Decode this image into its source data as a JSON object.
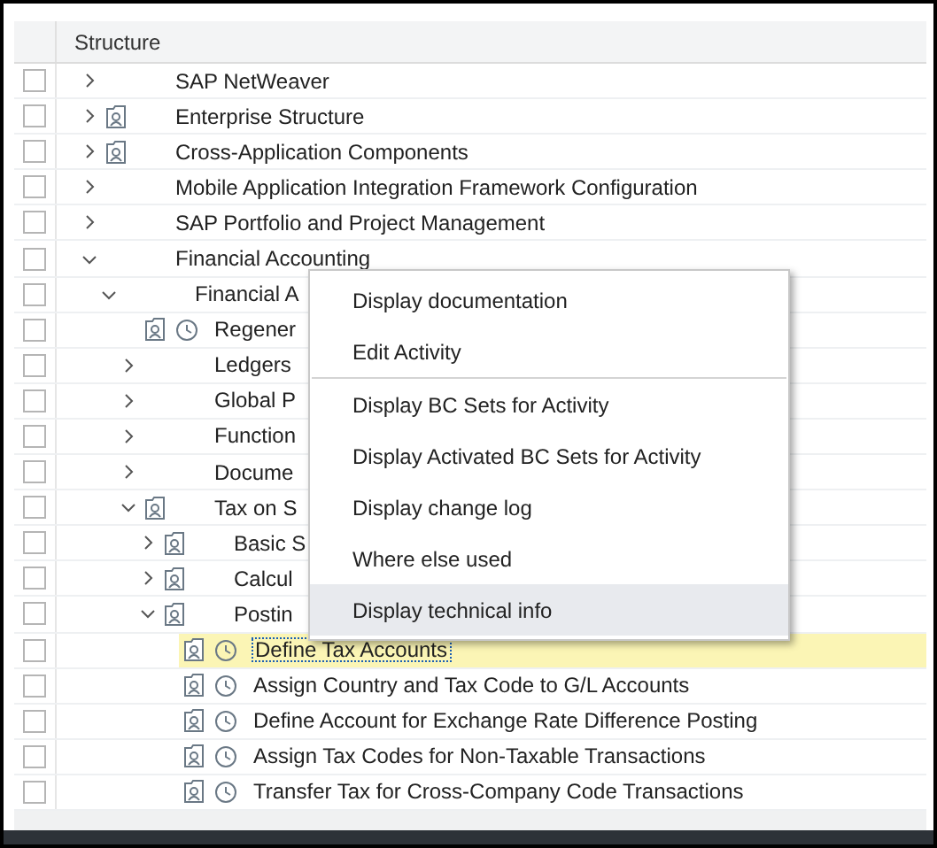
{
  "table": {
    "columns": [
      "Structure"
    ],
    "tree": [
      {
        "label": "SAP NetWeaver",
        "expanded": false,
        "doc_icon": false,
        "clock_icon": false,
        "checked": false,
        "selected": false
      },
      {
        "label": "Enterprise Structure",
        "expanded": false,
        "doc_icon": true,
        "clock_icon": false,
        "checked": false,
        "selected": false
      },
      {
        "label": "Cross-Application Components",
        "expanded": false,
        "doc_icon": true,
        "clock_icon": false,
        "checked": false,
        "selected": false
      },
      {
        "label": "Mobile Application Integration Framework Configuration",
        "expanded": false,
        "doc_icon": false,
        "clock_icon": false,
        "checked": false,
        "selected": false
      },
      {
        "label": "SAP Portfolio and Project Management",
        "expanded": false,
        "doc_icon": false,
        "clock_icon": false,
        "checked": false,
        "selected": false
      },
      {
        "label": "Financial Accounting",
        "expanded": true,
        "doc_icon": false,
        "clock_icon": false,
        "checked": false,
        "selected": false,
        "children": [
          {
            "label": "Financial A",
            "expanded": true,
            "doc_icon": false,
            "clock_icon": false,
            "checked": false,
            "selected": false,
            "children": [
              {
                "label": "Regener",
                "doc_icon": true,
                "clock_icon": true,
                "checked": false,
                "selected": false
              },
              {
                "label": "Ledgers",
                "expanded": false,
                "doc_icon": false,
                "clock_icon": false,
                "checked": false,
                "selected": false
              },
              {
                "label": "Global P",
                "expanded": false,
                "doc_icon": false,
                "clock_icon": false,
                "checked": false,
                "selected": false
              },
              {
                "label": "Function",
                "expanded": false,
                "doc_icon": false,
                "clock_icon": false,
                "checked": false,
                "selected": false
              },
              {
                "label": "Docume",
                "expanded": false,
                "doc_icon": false,
                "clock_icon": false,
                "checked": false,
                "selected": false
              },
              {
                "label": "Tax on S",
                "expanded": true,
                "doc_icon": true,
                "clock_icon": false,
                "checked": false,
                "selected": false,
                "children": [
                  {
                    "label": "Basic S",
                    "expanded": false,
                    "doc_icon": true,
                    "clock_icon": false,
                    "checked": false,
                    "selected": false
                  },
                  {
                    "label": "Calcul",
                    "expanded": false,
                    "doc_icon": true,
                    "clock_icon": false,
                    "checked": false,
                    "selected": false
                  },
                  {
                    "label": "Postin",
                    "expanded": true,
                    "doc_icon": true,
                    "clock_icon": false,
                    "checked": false,
                    "selected": false,
                    "children": [
                      {
                        "label": "Define Tax Accounts",
                        "doc_icon": true,
                        "clock_icon": true,
                        "checked": false,
                        "selected": true
                      },
                      {
                        "label": "Assign Country and Tax Code to G/L Accounts",
                        "doc_icon": true,
                        "clock_icon": true,
                        "checked": false,
                        "selected": false
                      },
                      {
                        "label": "Define Account for Exchange Rate Difference Posting",
                        "doc_icon": true,
                        "clock_icon": true,
                        "checked": false,
                        "selected": false
                      },
                      {
                        "label": "Assign Tax Codes for Non-Taxable Transactions",
                        "doc_icon": true,
                        "clock_icon": true,
                        "checked": false,
                        "selected": false
                      },
                      {
                        "label": "Transfer Tax for Cross-Company Code Transactions",
                        "doc_icon": true,
                        "clock_icon": true,
                        "checked": false,
                        "selected": false
                      }
                    ]
                  }
                ]
              }
            ]
          }
        ]
      }
    ]
  },
  "context_menu": [
    {
      "label": "Display documentation",
      "selected": false,
      "separator_after": false
    },
    {
      "label": "Edit Activity",
      "selected": false,
      "separator_after": true
    },
    {
      "label": "Display BC Sets for Activity",
      "selected": false,
      "separator_after": false
    },
    {
      "label": "Display Activated BC Sets for Activity",
      "selected": false,
      "separator_after": false
    },
    {
      "label": "Display change log",
      "selected": false,
      "separator_after": false
    },
    {
      "label": "Where else used",
      "selected": false,
      "separator_after": false
    },
    {
      "label": "Display technical info",
      "selected": true,
      "separator_after": false
    }
  ]
}
